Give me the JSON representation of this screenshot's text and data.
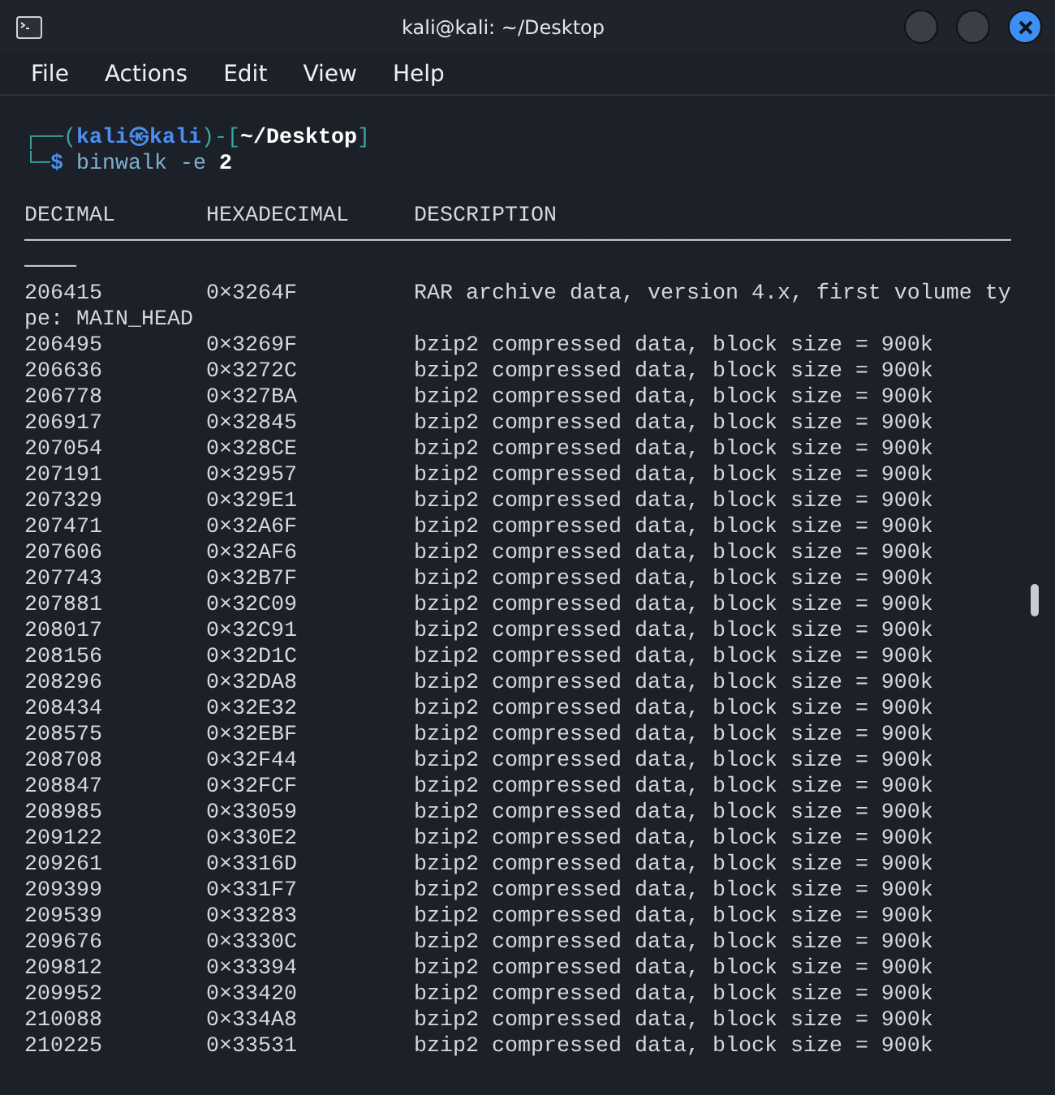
{
  "window": {
    "title": "kali@kali: ~/Desktop"
  },
  "menu": [
    "File",
    "Actions",
    "Edit",
    "View",
    "Help"
  ],
  "prompt": {
    "line_1": [
      {
        "kind": "frame",
        "text": "┌──("
      },
      {
        "kind": "user",
        "text": "kali㉿kali"
      },
      {
        "kind": "frame",
        "text": ")-["
      },
      {
        "kind": "path",
        "text": "~/Desktop"
      },
      {
        "kind": "frame",
        "text": "]"
      }
    ],
    "line_2": [
      {
        "kind": "frame",
        "text": "└─"
      },
      {
        "kind": "symbol",
        "text": "$ "
      },
      {
        "kind": "command",
        "text": "binwalk -e "
      },
      {
        "kind": "arg",
        "text": "2"
      }
    ]
  },
  "columns": [
    "DECIMAL",
    "HEXADECIMAL",
    "DESCRIPTION"
  ],
  "separator": [
    "────────────────────────────────────────────────────────────────────────────",
    "────"
  ],
  "rows": [
    {
      "decimal": "206415",
      "hex": "0×3264F",
      "description": "RAR archive data, version 4.x, first volume ty",
      "continuation": "pe: MAIN_HEAD"
    },
    {
      "decimal": "206495",
      "hex": "0×3269F",
      "description": "bzip2 compressed data, block size = 900k"
    },
    {
      "decimal": "206636",
      "hex": "0×3272C",
      "description": "bzip2 compressed data, block size = 900k"
    },
    {
      "decimal": "206778",
      "hex": "0×327BA",
      "description": "bzip2 compressed data, block size = 900k"
    },
    {
      "decimal": "206917",
      "hex": "0×32845",
      "description": "bzip2 compressed data, block size = 900k"
    },
    {
      "decimal": "207054",
      "hex": "0×328CE",
      "description": "bzip2 compressed data, block size = 900k"
    },
    {
      "decimal": "207191",
      "hex": "0×32957",
      "description": "bzip2 compressed data, block size = 900k"
    },
    {
      "decimal": "207329",
      "hex": "0×329E1",
      "description": "bzip2 compressed data, block size = 900k"
    },
    {
      "decimal": "207471",
      "hex": "0×32A6F",
      "description": "bzip2 compressed data, block size = 900k"
    },
    {
      "decimal": "207606",
      "hex": "0×32AF6",
      "description": "bzip2 compressed data, block size = 900k"
    },
    {
      "decimal": "207743",
      "hex": "0×32B7F",
      "description": "bzip2 compressed data, block size = 900k"
    },
    {
      "decimal": "207881",
      "hex": "0×32C09",
      "description": "bzip2 compressed data, block size = 900k"
    },
    {
      "decimal": "208017",
      "hex": "0×32C91",
      "description": "bzip2 compressed data, block size = 900k"
    },
    {
      "decimal": "208156",
      "hex": "0×32D1C",
      "description": "bzip2 compressed data, block size = 900k"
    },
    {
      "decimal": "208296",
      "hex": "0×32DA8",
      "description": "bzip2 compressed data, block size = 900k"
    },
    {
      "decimal": "208434",
      "hex": "0×32E32",
      "description": "bzip2 compressed data, block size = 900k"
    },
    {
      "decimal": "208575",
      "hex": "0×32EBF",
      "description": "bzip2 compressed data, block size = 900k"
    },
    {
      "decimal": "208708",
      "hex": "0×32F44",
      "description": "bzip2 compressed data, block size = 900k"
    },
    {
      "decimal": "208847",
      "hex": "0×32FCF",
      "description": "bzip2 compressed data, block size = 900k"
    },
    {
      "decimal": "208985",
      "hex": "0×33059",
      "description": "bzip2 compressed data, block size = 900k"
    },
    {
      "decimal": "209122",
      "hex": "0×330E2",
      "description": "bzip2 compressed data, block size = 900k"
    },
    {
      "decimal": "209261",
      "hex": "0×3316D",
      "description": "bzip2 compressed data, block size = 900k"
    },
    {
      "decimal": "209399",
      "hex": "0×331F7",
      "description": "bzip2 compressed data, block size = 900k"
    },
    {
      "decimal": "209539",
      "hex": "0×33283",
      "description": "bzip2 compressed data, block size = 900k"
    },
    {
      "decimal": "209676",
      "hex": "0×3330C",
      "description": "bzip2 compressed data, block size = 900k"
    },
    {
      "decimal": "209812",
      "hex": "0×33394",
      "description": "bzip2 compressed data, block size = 900k"
    },
    {
      "decimal": "209952",
      "hex": "0×33420",
      "description": "bzip2 compressed data, block size = 900k"
    },
    {
      "decimal": "210088",
      "hex": "0×334A8",
      "description": "bzip2 compressed data, block size = 900k"
    },
    {
      "decimal": "210225",
      "hex": "0×33531",
      "description": "bzip2 compressed data, block size = 900k"
    }
  ]
}
